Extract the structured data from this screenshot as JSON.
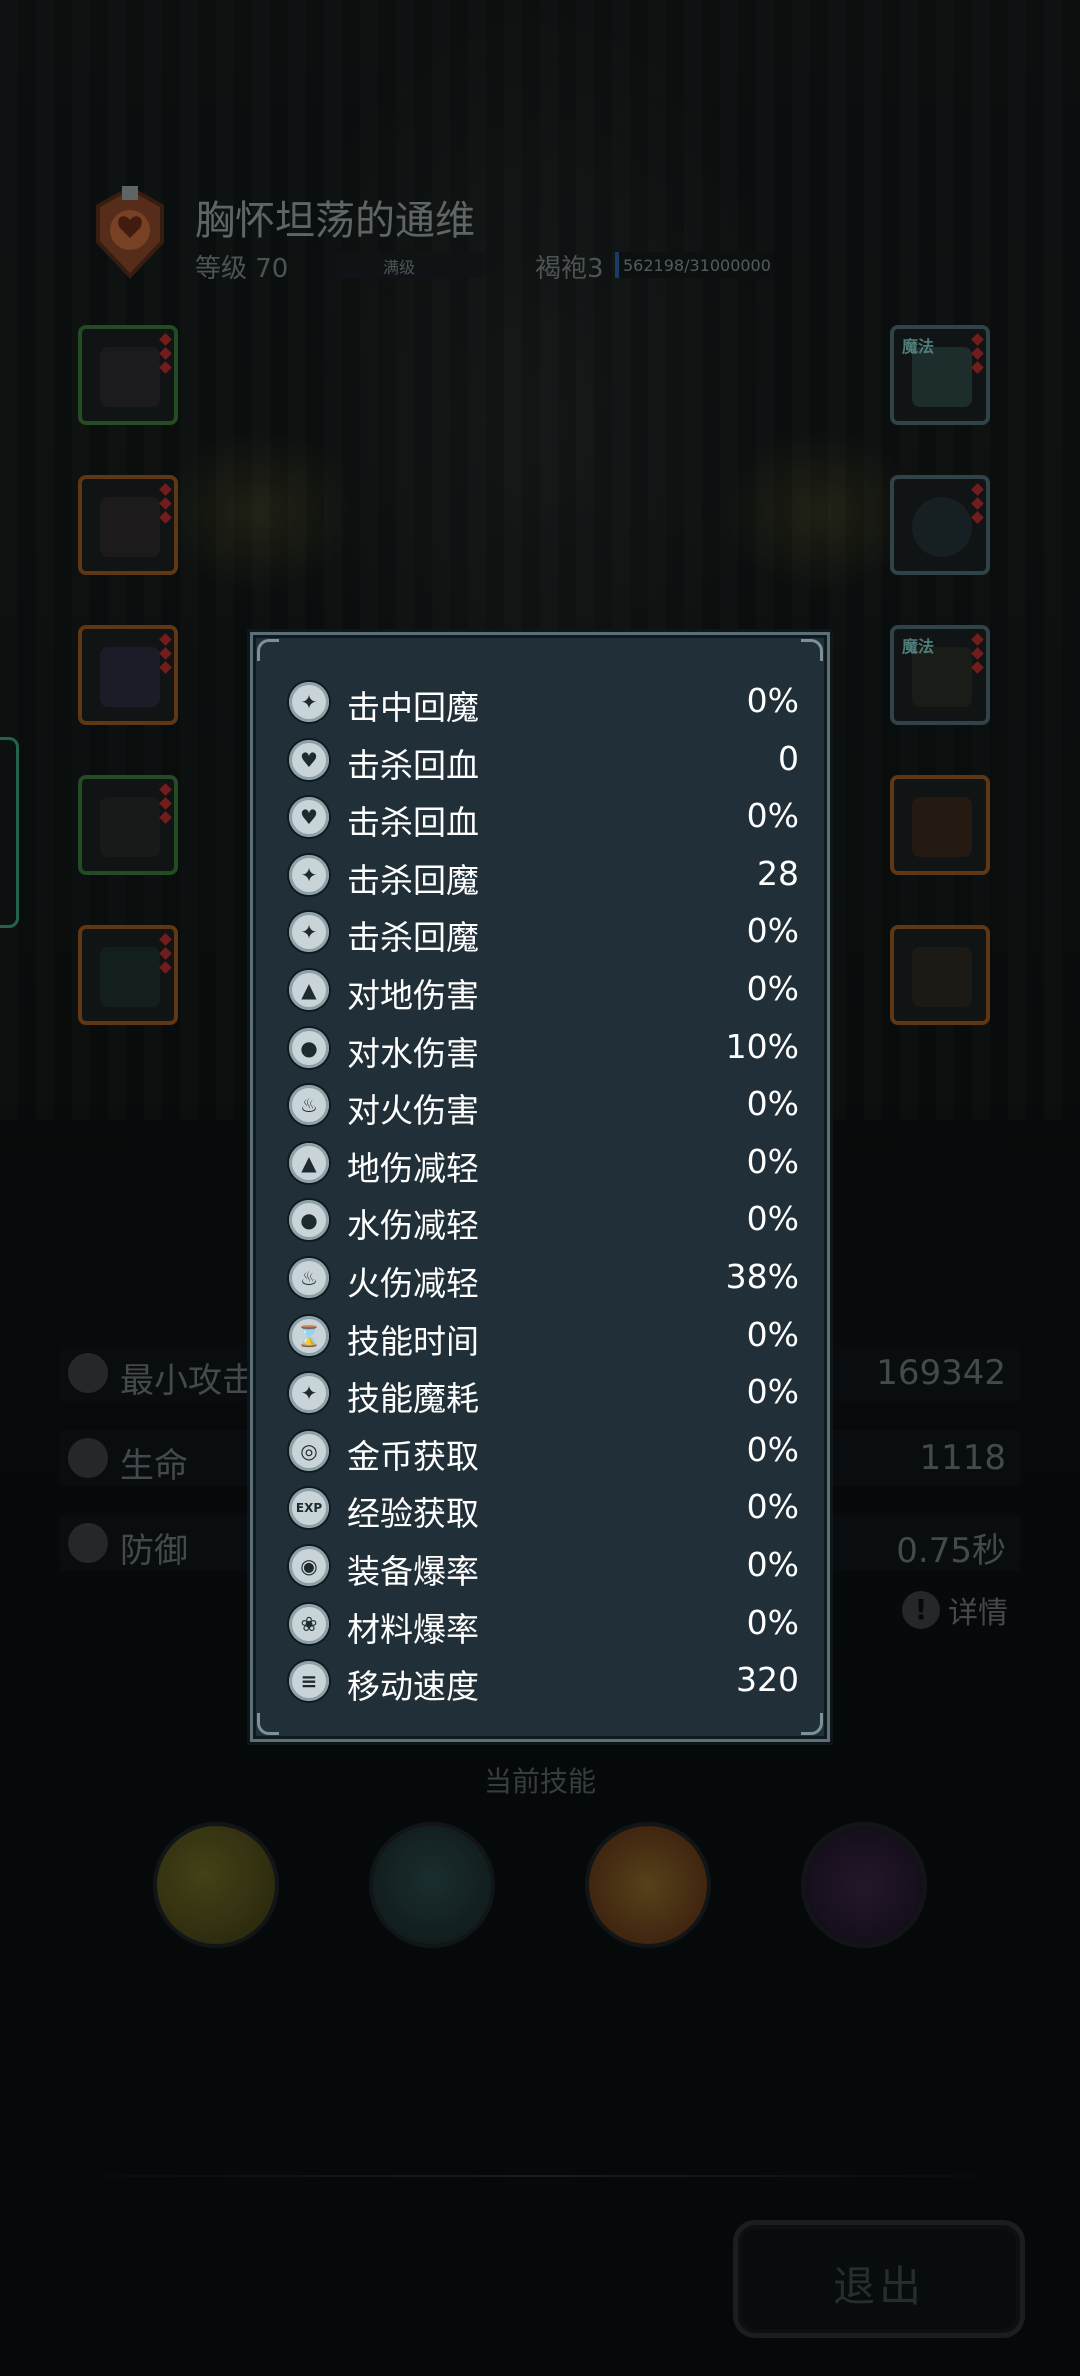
{
  "hero": {
    "name": "胸怀坦荡的通维",
    "level_label": "等级 70",
    "max_level_label": "满级",
    "class_label": "褐袍3",
    "exp_text": "562198/31000000"
  },
  "equipment": {
    "magic_badge": "魔法"
  },
  "base_stats": [
    {
      "label": "最小攻击",
      "value": "169342"
    },
    {
      "label": "生命",
      "value": "1118"
    },
    {
      "label": "防御",
      "value": "0.75秒"
    }
  ],
  "details_label": "详情",
  "skills_title": "当前技能",
  "exit_label": "退出",
  "popup_stats": [
    {
      "label": "击中回魔",
      "value": "0%",
      "icon": "mana-hit-icon"
    },
    {
      "label": "击杀回血",
      "value": "0",
      "icon": "heart-kill-icon"
    },
    {
      "label": "击杀回血",
      "value": "0%",
      "icon": "heart-kill-percent-icon"
    },
    {
      "label": "击杀回魔",
      "value": "28",
      "icon": "mana-kill-icon"
    },
    {
      "label": "击杀回魔",
      "value": "0%",
      "icon": "mana-kill-percent-icon"
    },
    {
      "label": "对地伤害",
      "value": "0%",
      "icon": "earth-damage-icon"
    },
    {
      "label": "对水伤害",
      "value": "10%",
      "icon": "water-damage-icon"
    },
    {
      "label": "对火伤害",
      "value": "0%",
      "icon": "fire-damage-icon"
    },
    {
      "label": "地伤减轻",
      "value": "0%",
      "icon": "earth-resist-icon"
    },
    {
      "label": "水伤减轻",
      "value": "0%",
      "icon": "water-resist-icon"
    },
    {
      "label": "火伤减轻",
      "value": "38%",
      "icon": "fire-resist-icon"
    },
    {
      "label": "技能时间",
      "value": "0%",
      "icon": "hourglass-icon"
    },
    {
      "label": "技能魔耗",
      "value": "0%",
      "icon": "mana-cost-icon"
    },
    {
      "label": "金币获取",
      "value": "0%",
      "icon": "coin-icon"
    },
    {
      "label": "经验获取",
      "value": "0%",
      "icon": "exp-icon"
    },
    {
      "label": "装备爆率",
      "value": "0%",
      "icon": "equipment-drop-icon"
    },
    {
      "label": "材料爆率",
      "value": "0%",
      "icon": "material-drop-icon"
    },
    {
      "label": "移动速度",
      "value": "320",
      "icon": "boot-icon"
    }
  ]
}
